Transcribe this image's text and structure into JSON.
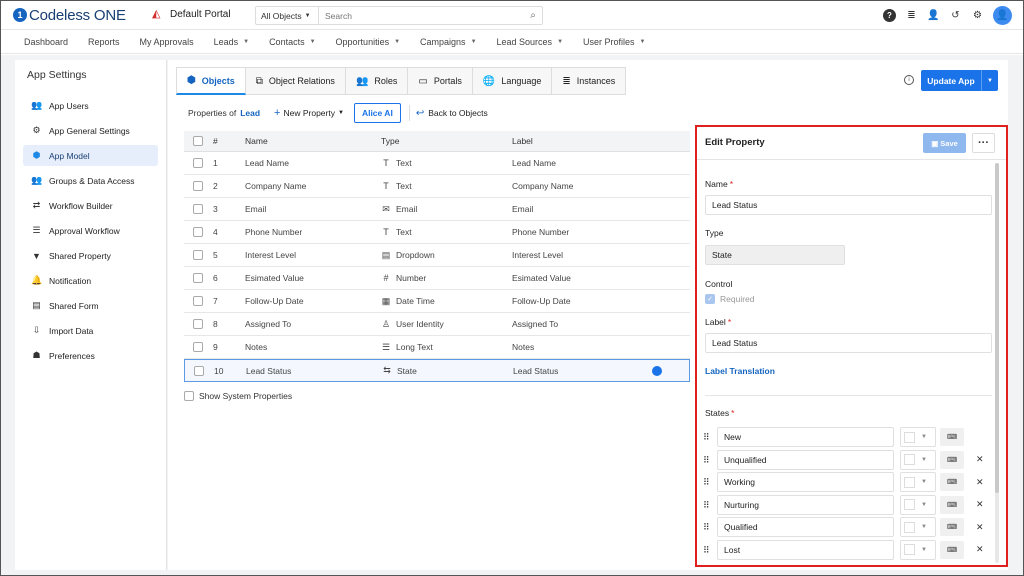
{
  "header": {
    "brand": "Codeless ONE",
    "portal": "Default Portal",
    "search_scope": "All Objects",
    "search_placeholder": "Search"
  },
  "nav": [
    "Dashboard",
    "Reports",
    "My Approvals",
    "Leads",
    "Contacts",
    "Opportunities",
    "Campaigns",
    "Lead Sources",
    "User Profiles"
  ],
  "nav_dropdown": [
    false,
    false,
    false,
    true,
    true,
    true,
    true,
    true,
    true
  ],
  "sidebar": {
    "title": "App Settings",
    "items": [
      {
        "label": "App Users",
        "icon": "users-icon"
      },
      {
        "label": "App General Settings",
        "icon": "gear-icon"
      },
      {
        "label": "App Model",
        "icon": "cube-icon"
      },
      {
        "label": "Groups & Data Access",
        "icon": "groups-icon"
      },
      {
        "label": "Workflow Builder",
        "icon": "workflow-icon"
      },
      {
        "label": "Approval Workflow",
        "icon": "checklist-icon"
      },
      {
        "label": "Shared Property",
        "icon": "shared-property-icon"
      },
      {
        "label": "Notification",
        "icon": "bell-icon"
      },
      {
        "label": "Shared Form",
        "icon": "form-icon"
      },
      {
        "label": "Import Data",
        "icon": "import-icon"
      },
      {
        "label": "Preferences",
        "icon": "preferences-icon"
      }
    ],
    "active_index": 2
  },
  "tabs": [
    "Objects",
    "Object Relations",
    "Roles",
    "Portals",
    "Language",
    "Instances"
  ],
  "update_app": "Update App",
  "toolbar": {
    "properties_of": "Properties of",
    "object": "Lead",
    "new_property": "New Property",
    "alice": "Alice AI",
    "back": "Back to Objects"
  },
  "table": {
    "headers": [
      "#",
      "Name",
      "Type",
      "Label"
    ],
    "rows": [
      {
        "num": "1",
        "name": "Lead Name",
        "type": "Text",
        "label": "Lead Name",
        "icon": "text-type-icon"
      },
      {
        "num": "2",
        "name": "Company Name",
        "type": "Text",
        "label": "Company Name",
        "icon": "text-type-icon"
      },
      {
        "num": "3",
        "name": "Email",
        "type": "Email",
        "label": "Email",
        "icon": "email-type-icon"
      },
      {
        "num": "4",
        "name": "Phone Number",
        "type": "Text",
        "label": "Phone Number",
        "icon": "text-type-icon"
      },
      {
        "num": "5",
        "name": "Interest Level",
        "type": "Dropdown",
        "label": "Interest Level",
        "icon": "dropdown-type-icon"
      },
      {
        "num": "6",
        "name": "Esimated Value",
        "type": "Number",
        "label": "Esimated Value",
        "icon": "number-type-icon"
      },
      {
        "num": "7",
        "name": "Follow-Up Date",
        "type": "Date Time",
        "label": "Follow-Up Date",
        "icon": "calendar-type-icon"
      },
      {
        "num": "8",
        "name": "Assigned To",
        "type": "User Identity",
        "label": "Assigned To",
        "icon": "user-type-icon"
      },
      {
        "num": "9",
        "name": "Notes",
        "type": "Long Text",
        "label": "Notes",
        "icon": "longtext-type-icon"
      },
      {
        "num": "10",
        "name": "Lead Status",
        "type": "State",
        "label": "Lead Status",
        "icon": "state-type-icon"
      }
    ],
    "selected_index": 9,
    "show_system": "Show System Properties"
  },
  "edit": {
    "title": "Edit Property",
    "save": "Save",
    "name_label": "Name",
    "name_value": "Lead Status",
    "type_label": "Type",
    "type_value": "State",
    "control_label": "Control",
    "required_label": "Required",
    "label_label": "Label",
    "label_value": "Lead Status",
    "translation": "Label Translation",
    "states_label": "States",
    "states": [
      "New",
      "Unqualified",
      "Working",
      "Nurturing",
      "Qualified",
      "Lost"
    ]
  }
}
